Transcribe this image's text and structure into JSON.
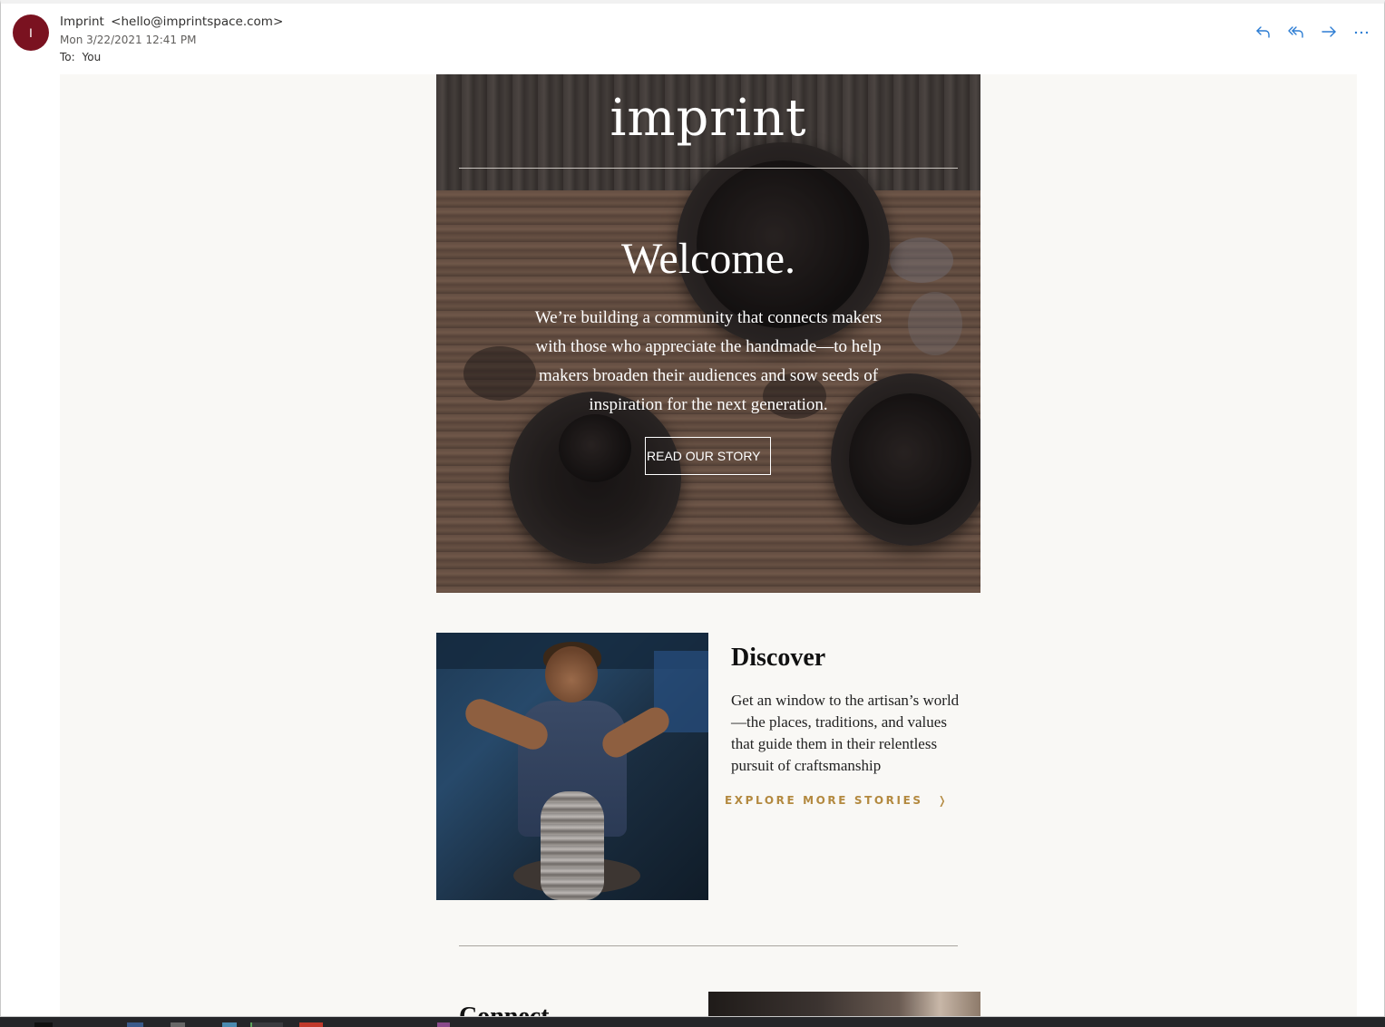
{
  "email": {
    "avatar_initial": "I",
    "sender_name": "Imprint",
    "sender_email": "<hello@imprintspace.com>",
    "date": "Mon 3/22/2021 12:41 PM",
    "to_label": "To:",
    "to_value": "You",
    "avatar_color": "#7a1220"
  },
  "actions": [
    {
      "name": "reply",
      "icon": "reply-icon"
    },
    {
      "name": "reply-all",
      "icon": "reply-all-icon"
    },
    {
      "name": "forward",
      "icon": "forward-icon"
    },
    {
      "name": "more",
      "icon": "more-icon"
    }
  ],
  "hero": {
    "logo": "imprint",
    "welcome": "Welcome.",
    "text": "We’re building a community that connects makers with those who appreciate the handmade—to help makers broaden their audiences and sow seeds of inspiration for the next generation.",
    "button": "READ OUR STORY"
  },
  "discover": {
    "title": "Discover",
    "text": "Get an window to the artisan’s world—the places, traditions, and values that guide them in their relentless pursuit of craftsmanship",
    "link": "EXPLORE MORE STORIES",
    "link_arrow": "❭",
    "link_color": "#b3893f"
  },
  "connect": {
    "title": "Connect"
  },
  "colors": {
    "email_background": "#f9f8f5",
    "action_icon": "#2b7cd3"
  }
}
